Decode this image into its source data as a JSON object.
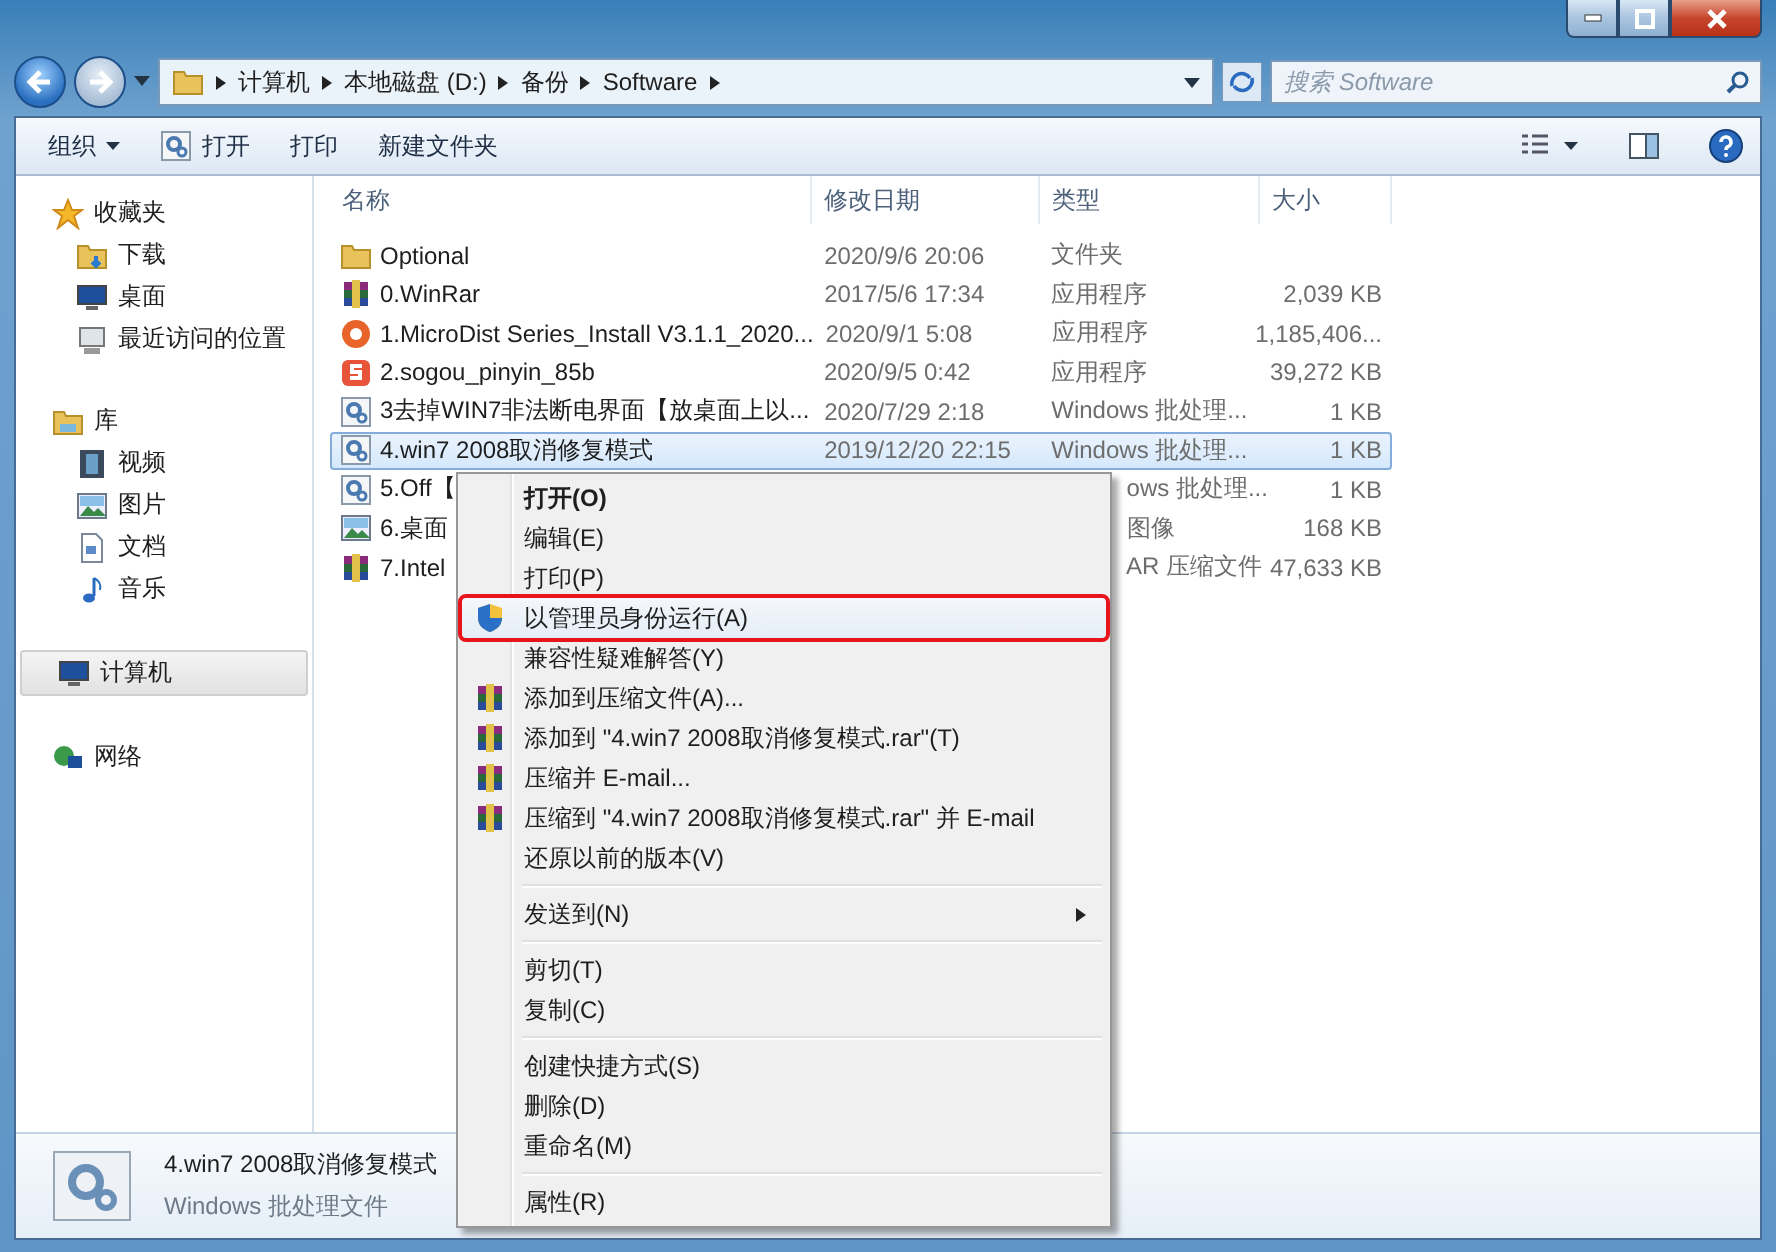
{
  "window": {
    "controls": [
      {
        "kind": "minimize"
      },
      {
        "kind": "maximize"
      },
      {
        "kind": "close"
      }
    ]
  },
  "address": {
    "crumbs": [
      "计算机",
      "本地磁盘 (D:)",
      "备份",
      "Software"
    ]
  },
  "search": {
    "placeholder": "搜索 Software"
  },
  "toolbar": {
    "items": [
      {
        "label": "组织",
        "kind": "menu"
      },
      {
        "label": "打开",
        "kind": "open"
      },
      {
        "label": "打印",
        "kind": "plain"
      },
      {
        "label": "新建文件夹",
        "kind": "plain"
      }
    ]
  },
  "nav": [
    {
      "label": "收藏夹",
      "kind": "star",
      "selected": false,
      "children": [
        {
          "label": "下载",
          "kind": "download"
        },
        {
          "label": "桌面",
          "kind": "desktop"
        },
        {
          "label": "最近访问的位置",
          "kind": "recent"
        }
      ]
    },
    {
      "label": "库",
      "kind": "library",
      "selected": false,
      "children": [
        {
          "label": "视频",
          "kind": "video"
        },
        {
          "label": "图片",
          "kind": "image"
        },
        {
          "label": "文档",
          "kind": "doc"
        },
        {
          "label": "音乐",
          "kind": "music"
        }
      ]
    },
    {
      "label": "计算机",
      "kind": "computer",
      "selected": true
    },
    {
      "label": "网络",
      "kind": "network",
      "selected": false
    }
  ],
  "table": {
    "columns": [
      "名称",
      "修改日期",
      "类型",
      "大小"
    ],
    "rows": [
      {
        "kind": "folder",
        "name": "Optional",
        "date": "2020/9/6 20:06",
        "type": "文件夹",
        "selected": false
      },
      {
        "kind": "rar",
        "name": "0.WinRar",
        "date": "2017/5/6 17:34",
        "type": "应用程序",
        "size": "2,039 KB",
        "selected": false
      },
      {
        "kind": "app",
        "name": "1.MicroDist Series_Install V3.1.1_2020...",
        "date": "2020/9/1 5:08",
        "type": "应用程序",
        "size": "1,185,406...",
        "selected": false
      },
      {
        "kind": "sogou",
        "name": "2.sogou_pinyin_85b",
        "date": "2020/9/5 0:42",
        "type": "应用程序",
        "size": "39,272 KB",
        "selected": false
      },
      {
        "kind": "batch",
        "name": "3去掉WIN7非法断电界面【放桌面上以...",
        "date": "2020/7/29 2:18",
        "type": "Windows 批处理...",
        "size": "1 KB",
        "selected": false
      },
      {
        "kind": "batch",
        "name": "4.win7 2008取消修复模式",
        "date": "2019/12/20 22:15",
        "type": "Windows 批处理...",
        "size": "1 KB",
        "selected": true
      },
      {
        "kind": "batch",
        "name": "5.Off【",
        "type": "ows 批处理...",
        "size": "1 KB",
        "selected": false
      },
      {
        "kind": "image",
        "name": "6.桌面",
        "type": "图像",
        "size": "168 KB",
        "selected": false
      },
      {
        "kind": "rar",
        "name": "7.Intel",
        "type": "AR 压缩文件",
        "size": "47,633 KB",
        "selected": false
      }
    ]
  },
  "details": {
    "name": "4.win7 2008取消修复模式",
    "type": "Windows 批处理文件"
  },
  "context_menu": {
    "groups": [
      [
        {
          "label": "打开(O)",
          "default": true
        },
        {
          "label": "编辑(E)"
        },
        {
          "label": "打印(P)"
        },
        {
          "label": "以管理员身份运行(A)",
          "kind": "shield",
          "highlighted": true
        },
        {
          "label": "兼容性疑难解答(Y)"
        },
        {
          "label": "添加到压缩文件(A)...",
          "kind": "rar"
        },
        {
          "label": "添加到 \"4.win7 2008取消修复模式.rar\"(T)",
          "kind": "rar"
        },
        {
          "label": "压缩并 E-mail...",
          "kind": "rar"
        },
        {
          "label": "压缩到 \"4.win7 2008取消修复模式.rar\" 并 E-mail",
          "kind": "rar"
        },
        {
          "label": "还原以前的版本(V)"
        }
      ],
      [
        {
          "label": "发送到(N)",
          "submenu": true
        }
      ],
      [
        {
          "label": "剪切(T)"
        },
        {
          "label": "复制(C)"
        }
      ],
      [
        {
          "label": "创建快捷方式(S)"
        },
        {
          "label": "删除(D)"
        },
        {
          "label": "重命名(M)"
        }
      ],
      [
        {
          "label": "属性(R)"
        }
      ]
    ]
  }
}
